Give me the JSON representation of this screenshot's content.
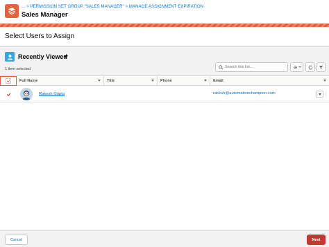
{
  "header": {
    "icon": "layers-icon",
    "accent_color": "#e3633f",
    "breadcrumb": "... > PERMISSION SET GROUP \"SALES MANAGER\" > MANAGE ASSIGNMENT EXPIRATION",
    "title": "Sales Manager"
  },
  "section": {
    "title": "Select Users to Assign"
  },
  "list_view": {
    "icon": "user-icon",
    "title": "Recently Viewed",
    "selected_count": "1 item selected",
    "search_placeholder": "Search this list...",
    "columns": [
      "Full Name",
      "Title",
      "Phone",
      "Email"
    ],
    "rows": [
      {
        "selected": true,
        "full_name": "Rakesh Gupta",
        "title": "",
        "phone": "",
        "email": "rakesh@automationchampion.com"
      }
    ]
  },
  "footer": {
    "cancel_label": "Cancel",
    "next_label": "Next",
    "primary_color": "#c23934"
  }
}
